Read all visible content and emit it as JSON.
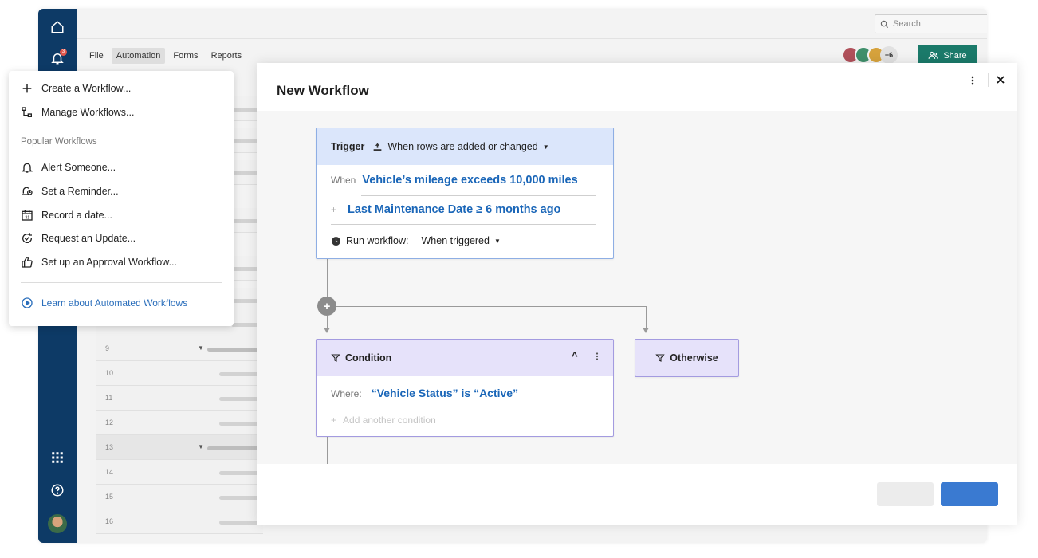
{
  "sidebar": {
    "notification_count": "3"
  },
  "topbar": {
    "search_placeholder": "Search"
  },
  "menubar": {
    "tabs": [
      "File",
      "Automation",
      "Forms",
      "Reports"
    ]
  },
  "collaborators": {
    "extra_count": "+6"
  },
  "share": {
    "label": "Share"
  },
  "grid": {
    "row_numbers": [
      "9",
      "10",
      "11",
      "12",
      "13",
      "14",
      "15",
      "16"
    ]
  },
  "dropdown": {
    "create": "Create a Workflow...",
    "manage": "Manage Workflows...",
    "section_title": "Popular Workflows",
    "popular": [
      "Alert Someone...",
      "Set a Reminder...",
      "Record a date...",
      "Request an Update...",
      "Set up an Approval Workflow..."
    ],
    "learn": "Learn about Automated Workflows"
  },
  "modal": {
    "title": "New Workflow",
    "trigger": {
      "label": "Trigger",
      "event": "When rows are added or changed",
      "when_label": "When",
      "condition_1": "Vehicle’s mileage exceeds 10,000 miles",
      "condition_2": "Last Maintenance Date ≥ 6 months ago",
      "run_label": "Run workflow:",
      "run_value": "When triggered"
    },
    "condition": {
      "label": "Condition",
      "where_label": "Where:",
      "value": "“Vehicle Status” is “Active”",
      "add_another": "Add another condition"
    },
    "otherwise": {
      "label": "Otherwise"
    }
  },
  "colors": {
    "sidebar": "#0d3a66",
    "share": "#1b7a6a",
    "primary_button": "#3a7ad1",
    "link_blue": "#1a66b8",
    "trigger_header": "#dbe6fb",
    "condition_header": "#e6e2fa"
  }
}
